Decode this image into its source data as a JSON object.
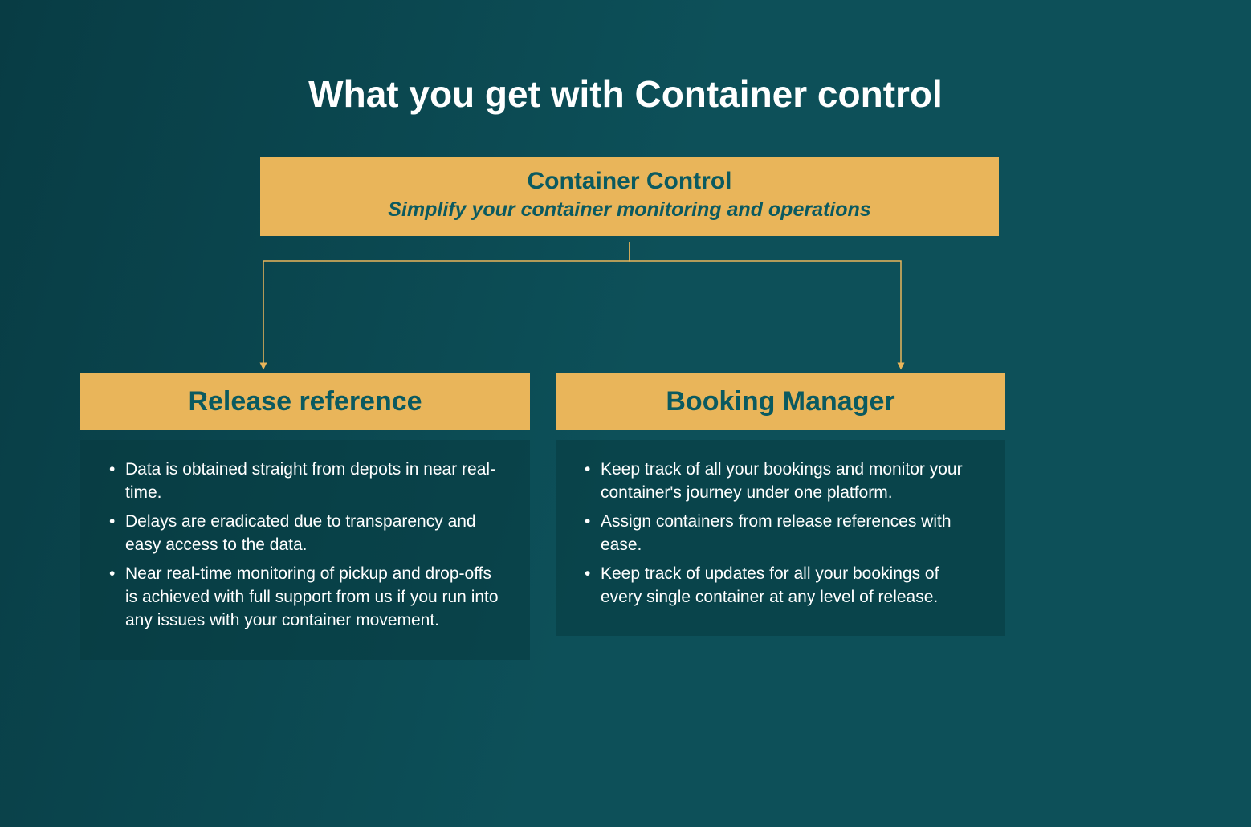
{
  "title": "What you get with Container control",
  "hero": {
    "heading": "Container Control",
    "sub": "Simplify your container monitoring and operations"
  },
  "features": {
    "left": {
      "heading": "Release reference",
      "bullets": [
        "Data is obtained straight from depots in near real-time.",
        "Delays are eradicated due to transparency and easy access to the data.",
        " Near real-time monitoring of pickup and drop-offs is achieved with full support from us if you run into any issues with your container movement."
      ]
    },
    "right": {
      "heading": "Booking Manager",
      "bullets": [
        "Keep track of all your bookings and monitor your container's journey under one platform.",
        "Assign containers from release references with ease.",
        "Keep track of updates for all your bookings of every single container at any level of release."
      ]
    }
  },
  "colors": {
    "accent": "#e9b55a",
    "text_on_accent": "#0b5a60",
    "bg_start": "#083c44",
    "bg_end": "#0d5059"
  }
}
